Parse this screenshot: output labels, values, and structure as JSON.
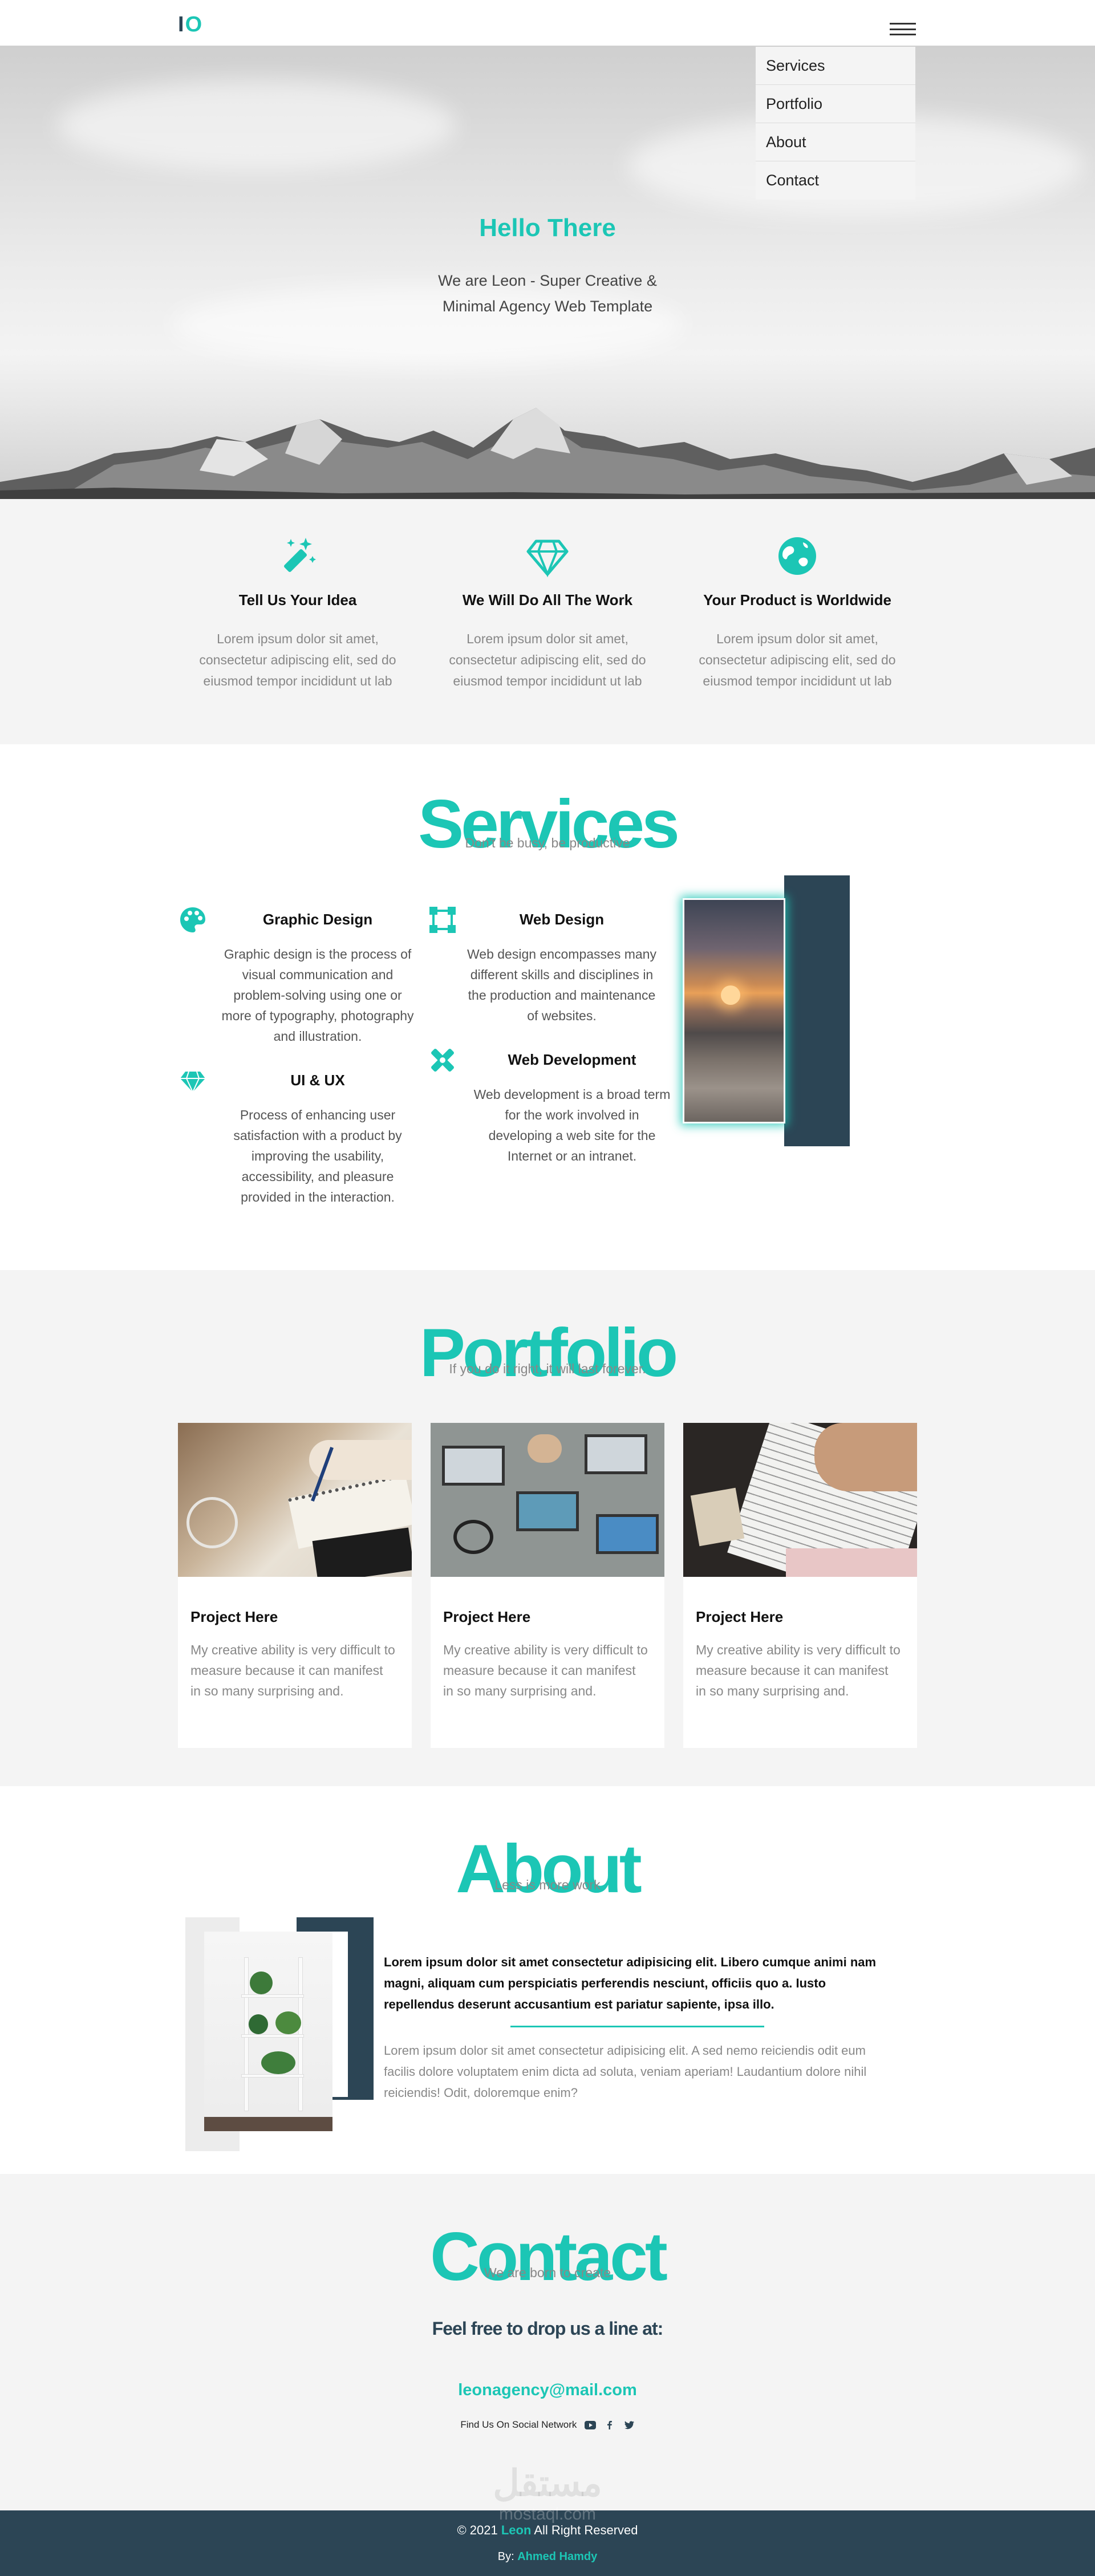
{
  "header": {
    "logo_l": "I",
    "logo_o": "O"
  },
  "menu": {
    "items": [
      "Services",
      "Portfolio",
      "About",
      "Contact"
    ]
  },
  "hero": {
    "title": "Hello There",
    "subtitle": "We are Leon - Super Creative & Minimal Agency Web Template"
  },
  "features": [
    {
      "icon": "magic-wand-icon",
      "title": "Tell Us Your Idea",
      "text": "Lorem ipsum dolor sit amet, consectetur adipiscing elit, sed do eiusmod tempor incididunt ut lab"
    },
    {
      "icon": "diamond-icon",
      "title": "We Will Do All The Work",
      "text": "Lorem ipsum dolor sit amet, consectetur adipiscing elit, sed do eiusmod tempor incididunt ut lab"
    },
    {
      "icon": "globe-icon",
      "title": "Your Product is Worldwide",
      "text": "Lorem ipsum dolor sit amet, consectetur adipiscing elit, sed do eiusmod tempor incididunt ut lab"
    }
  ],
  "services": {
    "title": "Services",
    "subtitle": "Don't be busy, be productive",
    "items": [
      {
        "icon": "palette-icon",
        "title": "Graphic Design",
        "text": "Graphic design is the process of visual communication and problem-solving using one or more of typography, photography and illustration."
      },
      {
        "icon": "vector-square-icon",
        "title": "Web Design",
        "text": "Web design encompasses many different skills and disciplines in the production and maintenance of websites."
      },
      {
        "icon": "gem-icon",
        "title": "UI & UX",
        "text": "Process of enhancing user satisfaction with a product by improving the usability, accessibility, and pleasure provided in the interaction."
      },
      {
        "icon": "tools-icon",
        "title": "Web Development",
        "text": "Web development is a broad term for the work involved in developing a web site for the Internet or an intranet."
      }
    ]
  },
  "portfolio": {
    "title": "Portfolio",
    "subtitle": "If you do it right, it will last forever.",
    "cards": [
      {
        "title": "Project Here",
        "text": "My creative ability is very difficult to measure because it can manifest in so many surprising and."
      },
      {
        "title": "Project Here",
        "text": "My creative ability is very difficult to measure because it can manifest in so many surprising and."
      },
      {
        "title": "Project Here",
        "text": "My creative ability is very difficult to measure because it can manifest in so many surprising and."
      }
    ]
  },
  "about": {
    "title": "About",
    "subtitle": "Less is more work",
    "bold": "Lorem ipsum dolor sit amet consectetur adipisicing elit. Libero cumque animi nam magni, aliquam cum perspiciatis perferendis nesciunt, officiis quo a. Iusto repellendus deserunt accusantium est pariatur sapiente, ipsa illo.",
    "text": "Lorem ipsum dolor sit amet consectetur adipisicing elit. A sed nemo reiciendis odit eum facilis dolore voluptatem enim dicta ad soluta, veniam aperiam! Laudantium dolore nihil reiciendis! Odit, doloremque enim?"
  },
  "contact": {
    "title": "Contact",
    "subtitle": "We are born to create",
    "line": "Feel free to drop us a line at:",
    "email": "leonagency@mail.com",
    "social": "Find Us On Social Network",
    "social_icons": [
      "youtube-icon",
      "facebook-icon",
      "twitter-icon"
    ],
    "watermark": "مستقل"
  },
  "footer": {
    "watermark": "mostaql.com",
    "copy_pre": "© 2021",
    "brand": "Leon",
    "copy_post": "All Right Reserved",
    "by_pre": "By:",
    "author": "Ahmed Hamdy"
  },
  "colors": {
    "accent": "#1cc6b5",
    "dark": "#2c4555",
    "light_bg": "#f4f4f4"
  }
}
